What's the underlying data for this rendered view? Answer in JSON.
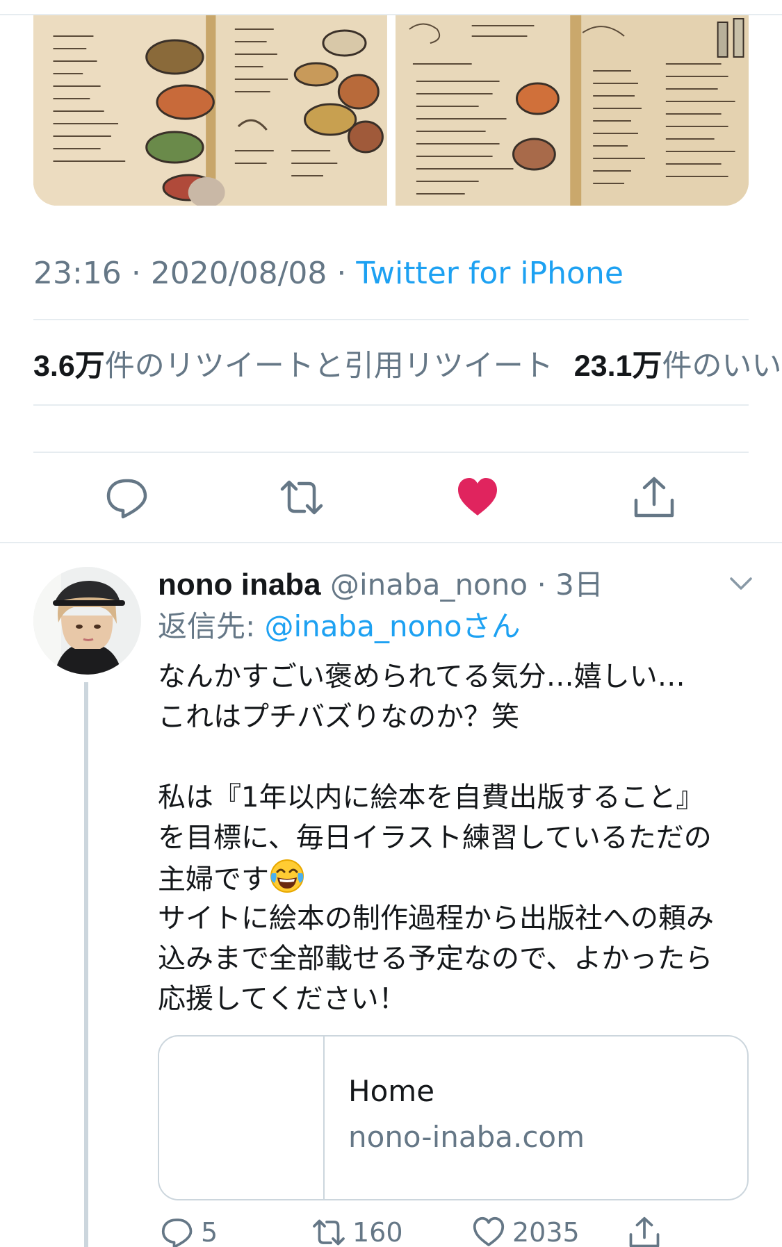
{
  "tweet": {
    "time": "23:16",
    "date": "2020/08/08",
    "separator": "·",
    "source": "Twitter for iPhone",
    "retweet_count": "3.6万",
    "retweet_label": "件のリツイートと引用リツイート",
    "like_count": "23.1万",
    "like_label": "件のいいね",
    "actions": {
      "reply_icon": "reply-icon",
      "retweet_icon": "retweet-icon",
      "like_icon": "heart-filled-icon",
      "share_icon": "share-icon",
      "like_color": "#e0245e"
    }
  },
  "reply": {
    "name": "nono inaba",
    "handle": "@inaba_nono",
    "dot": "·",
    "age": "3日",
    "reply_to_label": "返信先:",
    "reply_to_handle": "@inaba_nonoさん",
    "lines": [
      "なんかすごい褒められてる気分…嬉しい…",
      "これはプチバズりなのか？笑",
      "",
      "私は『1年以内に絵本を自費出版すること』",
      "を目標に、毎日イラスト練習しているただの",
      "主婦です",
      "サイトに絵本の制作過程から出版社への頼み",
      "込みまで全部載せる予定なので、よかったら",
      "応援してください！"
    ],
    "emoji": "face-with-tears-of-joy-icon",
    "card": {
      "title": "Home",
      "domain": "nono-inaba.com"
    },
    "counts": {
      "replies": "5",
      "retweets": "160",
      "likes": "2035"
    }
  },
  "colors": {
    "accent": "#1da1f2",
    "secondary_text": "#657786",
    "divider": "#e6ecf0",
    "like": "#e0245e"
  }
}
